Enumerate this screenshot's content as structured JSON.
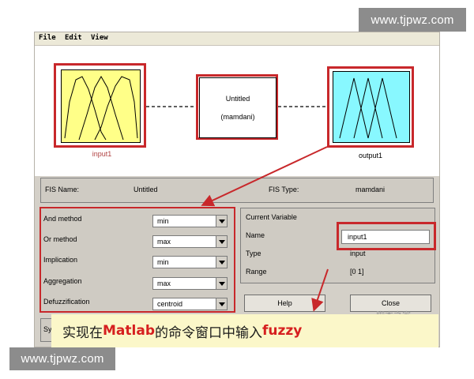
{
  "watermark": {
    "top": "www.tjpwz.com",
    "bottom": "www.tjpwz.com",
    "overlay": "脚本之家"
  },
  "menu": [
    "File",
    "Edit",
    "View"
  ],
  "diagram": {
    "input_label": "input1",
    "output_label": "output1",
    "system_title": "Untitled",
    "system_type": "(mamdani)"
  },
  "info_bar": {
    "fis_name_label": "FIS Name:",
    "fis_name_value": "Untitled",
    "fis_type_label": "FIS Type:",
    "fis_type_value": "mamdani"
  },
  "methods": [
    {
      "label": "And method",
      "value": "min"
    },
    {
      "label": "Or method",
      "value": "max"
    },
    {
      "label": "Implication",
      "value": "min"
    },
    {
      "label": "Aggregation",
      "value": "max"
    },
    {
      "label": "Defuzzification",
      "value": "centroid"
    }
  ],
  "current_variable": {
    "heading": "Current Variable",
    "name_label": "Name",
    "name_value": "input1",
    "type_label": "Type",
    "type_value": "input",
    "range_label": "Range",
    "range_value": "[0 1]"
  },
  "buttons": {
    "help": "Help",
    "close": "Close"
  },
  "status_fragment": "Sy",
  "caption": {
    "part1": "实现在",
    "part2": "Matlab",
    "part3": "的命令窗口中输入",
    "part4": "fuzzy"
  },
  "colors": {
    "input_fill": "#ffff88",
    "output_fill": "#88f8ff",
    "highlight": "#c8282b",
    "caption_bg": "#fbf7c9"
  }
}
